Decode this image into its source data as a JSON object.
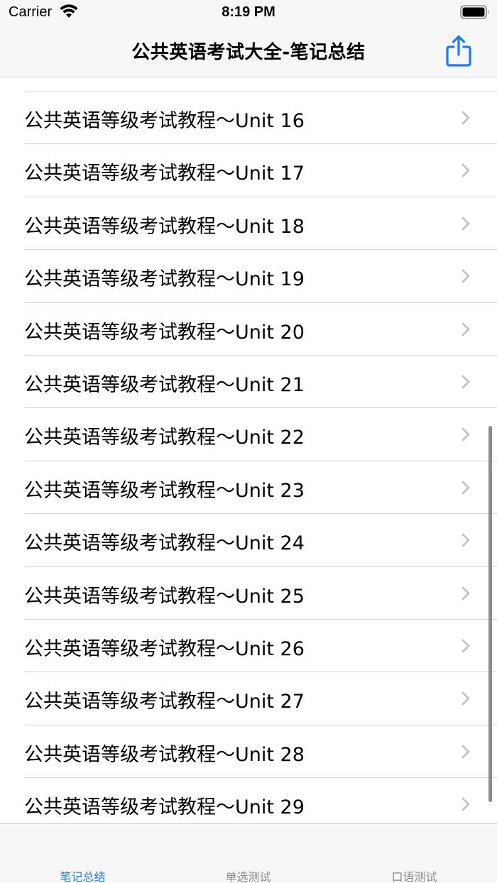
{
  "status_bar": {
    "carrier": "Carrier",
    "time": "8:19 PM"
  },
  "nav": {
    "title": "公共英语考试大全-笔记总结",
    "share_icon": "share-icon",
    "accent_color": "#1a7cf5"
  },
  "list": {
    "items": [
      {
        "label": "公共英语等级考试教程～Unit 16"
      },
      {
        "label": "公共英语等级考试教程～Unit 17"
      },
      {
        "label": "公共英语等级考试教程～Unit 18"
      },
      {
        "label": "公共英语等级考试教程～Unit 19"
      },
      {
        "label": "公共英语等级考试教程～Unit 20"
      },
      {
        "label": "公共英语等级考试教程～Unit 21"
      },
      {
        "label": "公共英语等级考试教程～Unit 22"
      },
      {
        "label": "公共英语等级考试教程～Unit 23"
      },
      {
        "label": "公共英语等级考试教程～Unit 24"
      },
      {
        "label": "公共英语等级考试教程～Unit 25"
      },
      {
        "label": "公共英语等级考试教程～Unit 26"
      },
      {
        "label": "公共英语等级考试教程～Unit 27"
      },
      {
        "label": "公共英语等级考试教程～Unit 28"
      },
      {
        "label": "公共英语等级考试教程～Unit 29"
      }
    ],
    "chevron_icon": "chevron-right-icon",
    "chevron_color": "#c4c4c7"
  },
  "tab_bar": {
    "tabs": [
      {
        "label": "笔记总结",
        "selected": true
      },
      {
        "label": "单选测试",
        "selected": false
      },
      {
        "label": "口语测试",
        "selected": false
      }
    ],
    "selected_color": "#1a7cf5",
    "unselected_color": "#8a8a8e"
  }
}
